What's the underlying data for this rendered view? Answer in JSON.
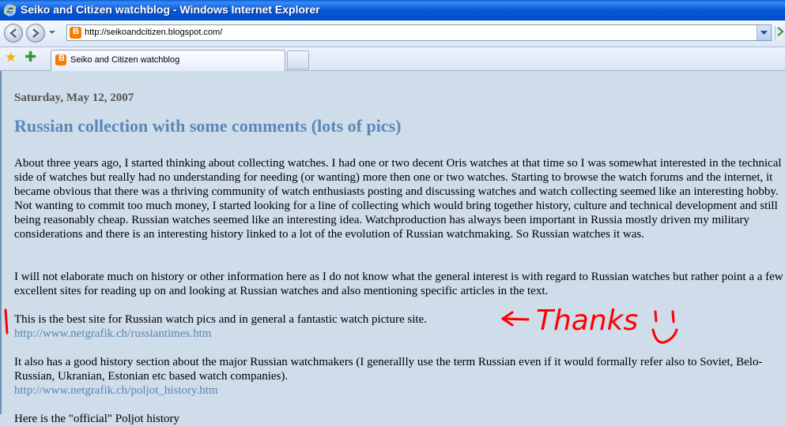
{
  "window": {
    "title": "Seiko and Citizen watchblog - Windows Internet Explorer"
  },
  "address_bar": {
    "url": "http://seikoandcitizen.blogspot.com/",
    "favicon": "blogger-icon",
    "favicon_letter": "B"
  },
  "tabs": [
    {
      "label": "Seiko and Citizen watchblog"
    }
  ],
  "post": {
    "date": "Saturday, May 12, 2007",
    "title": "Russian collection with some comments (lots of pics)",
    "paragraphs": [
      "About three years ago, I started thinking about collecting watches. I had one or two decent Oris watches at that time so I was somewhat interested in the technical side of watches but really had no understanding for needing (or wanting) more then one or two watches. Starting to browse the watch forums and the internet, it became obvious that there was a thriving community of watch enthusiasts posting and discussing watches and watch collecting seemed like an interesting hobby. Not wanting to commit too much money, I started looking for a line of collecting which would bring together history, culture and technical development and still being reasonably cheap. Russian watches seemed like an interesting idea. Watchproduction has always been important in Russia mostly driven my military considerations and there is an interesting history linked to a lot of the evolution of Russian watchmaking. So Russian watches it was.",
      "I will not elaborate much on history or other information here as I do not know what the general interest is with regard to Russian watches but rather point a a few excellent sites for reading up on and looking at Russian watches and also mentioning specific articles in the text.",
      "This is the best site for Russian watch pics and in general a fantastic watch picture site.",
      "It also has a good history section about the major Russian watchmakers (I generallly use the term Russian even if it would formally refer also to Soviet, Belo-Russian, Ukranian, Estonian etc based watch companies)."
    ],
    "links": [
      "http://www.netgrafik.ch/russiantimes.htm",
      "http://www.netgrafik.ch/poljot_history.htm"
    ],
    "partial_next_line": "Here is the \"official\" Poljot history"
  },
  "annotation": {
    "text": "Thanks",
    "color": "#ff0000"
  }
}
